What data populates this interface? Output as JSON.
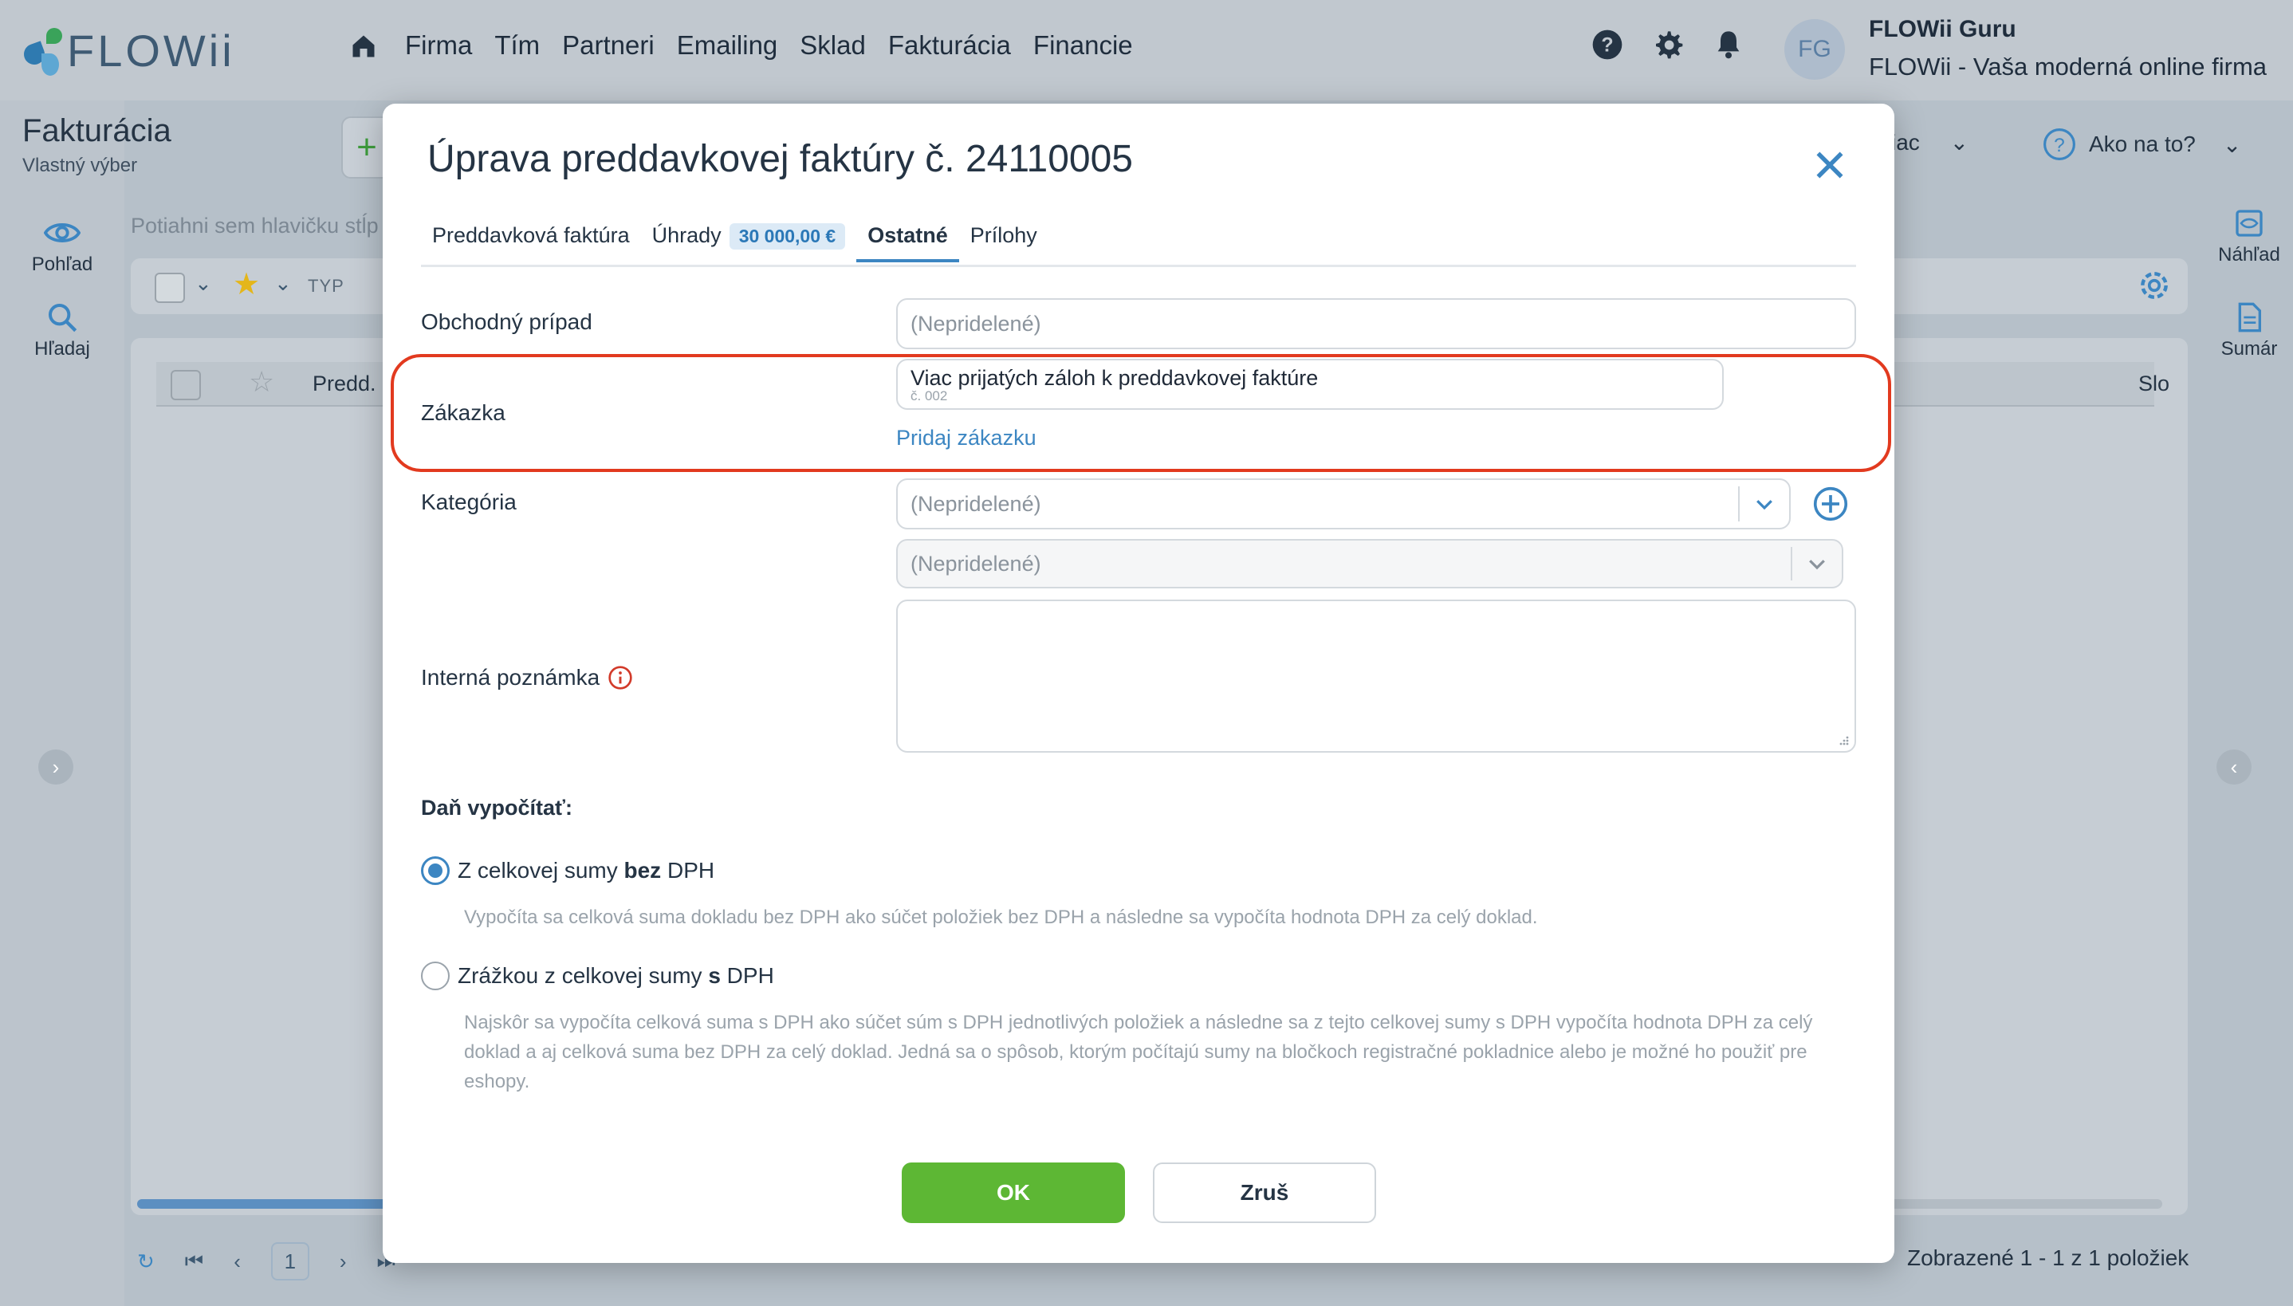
{
  "app": {
    "logo_text": "FLOWii",
    "nav": [
      "Firma",
      "Tím",
      "Partneri",
      "Emailing",
      "Sklad",
      "Fakturácia",
      "Financie"
    ],
    "user_initials": "FG",
    "user_name": "FLOWii Guru",
    "user_company": "FLOWii - Vaša moderná online firma"
  },
  "page": {
    "title": "Fakturácia",
    "subtitle": "Vlastný výber",
    "rail_left": [
      "Pohľad",
      "Hľadaj"
    ],
    "rail_right": [
      "Náhľad",
      "Sumár"
    ],
    "right_head_more": "iac",
    "right_head_help": "Ako na to?",
    "drop_hint": "Potiahni sem hlavičku stĺp",
    "toolbar_type": "TYP",
    "column_predd": "Predd.",
    "column_slo": "Slo",
    "pager_page": "1",
    "summary": "Zobrazené 1 - 1 z 1 položiek"
  },
  "modal": {
    "title": "Úprava preddavkovej faktúry č. 24110005",
    "tabs": {
      "t1": "Preddavková faktúra",
      "t2": "Úhrady",
      "t2_badge": "30 000,00 €",
      "t3": "Ostatné",
      "t4": "Prílohy"
    },
    "fields": {
      "obchodny_label": "Obchodný prípad",
      "obchodny_placeholder": "(Nepridelené)",
      "zakazka_label": "Zákazka",
      "zakazka_value": "Viac prijatých záloh k preddavkovej faktúre",
      "zakazka_sub": "č. 002",
      "zakazka_link": "Pridaj zákazku",
      "kategoria_label": "Kategória",
      "kategoria_value": "(Nepridelené)",
      "kategoria2_value": "(Nepridelené)",
      "poznamka_label": "Interná poznámka"
    },
    "tax": {
      "title": "Daň vypočítať:",
      "opt1_pre": "Z celkovej sumy ",
      "opt1_bold": "bez",
      "opt1_post": " DPH",
      "opt1_desc": "Vypočíta sa celková suma dokladu bez DPH ako súčet položiek bez DPH a následne sa vypočíta hodnota DPH za celý doklad.",
      "opt2_pre": "Zrážkou z celkovej sumy ",
      "opt2_bold": "s",
      "opt2_post": " DPH",
      "opt2_desc": "Najskôr sa vypočíta celková suma s DPH ako súčet súm s DPH jednotlivých položiek a následne sa z tejto celkovej sumy s DPH vypočíta hodnota DPH za celý doklad a aj celková suma bez DPH za celý doklad. Jedná sa o spôsob, ktorým počítajú sumy na bločkoch registračné pokladnice alebo je možné ho použiť pre eshopy."
    },
    "buttons": {
      "ok": "OK",
      "cancel": "Zruš"
    }
  },
  "colors": {
    "accent": "#3c86c2",
    "ok": "#5db734",
    "highlight": "#e23a1f"
  }
}
